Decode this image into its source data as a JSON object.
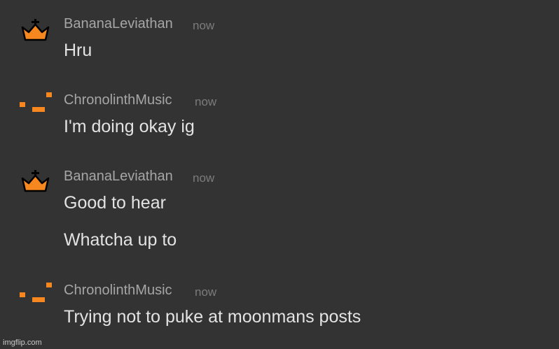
{
  "messages": [
    {
      "username": "BananaLeviathan",
      "timestamp": "now",
      "avatar_icon": "crown-icon",
      "lines": [
        "Hru"
      ]
    },
    {
      "username": "ChronolinthMusic",
      "timestamp": "now",
      "avatar_icon": "pixel-dashes-icon",
      "lines": [
        "I'm doing okay ig"
      ]
    },
    {
      "username": "BananaLeviathan",
      "timestamp": "now",
      "avatar_icon": "crown-icon",
      "lines": [
        "Good to hear",
        "Whatcha up to"
      ]
    },
    {
      "username": "ChronolinthMusic",
      "timestamp": "now",
      "avatar_icon": "pixel-dashes-icon",
      "lines": [
        "Trying not to puke at moonmans posts"
      ]
    }
  ],
  "watermark": "imgflip.com",
  "colors": {
    "background": "#333333",
    "avatar_accent": "#f7871f",
    "crown_outline": "#000000",
    "username": "#a6a6a6",
    "timestamp": "#7c7c7c",
    "message_text": "#e3e3e3"
  }
}
